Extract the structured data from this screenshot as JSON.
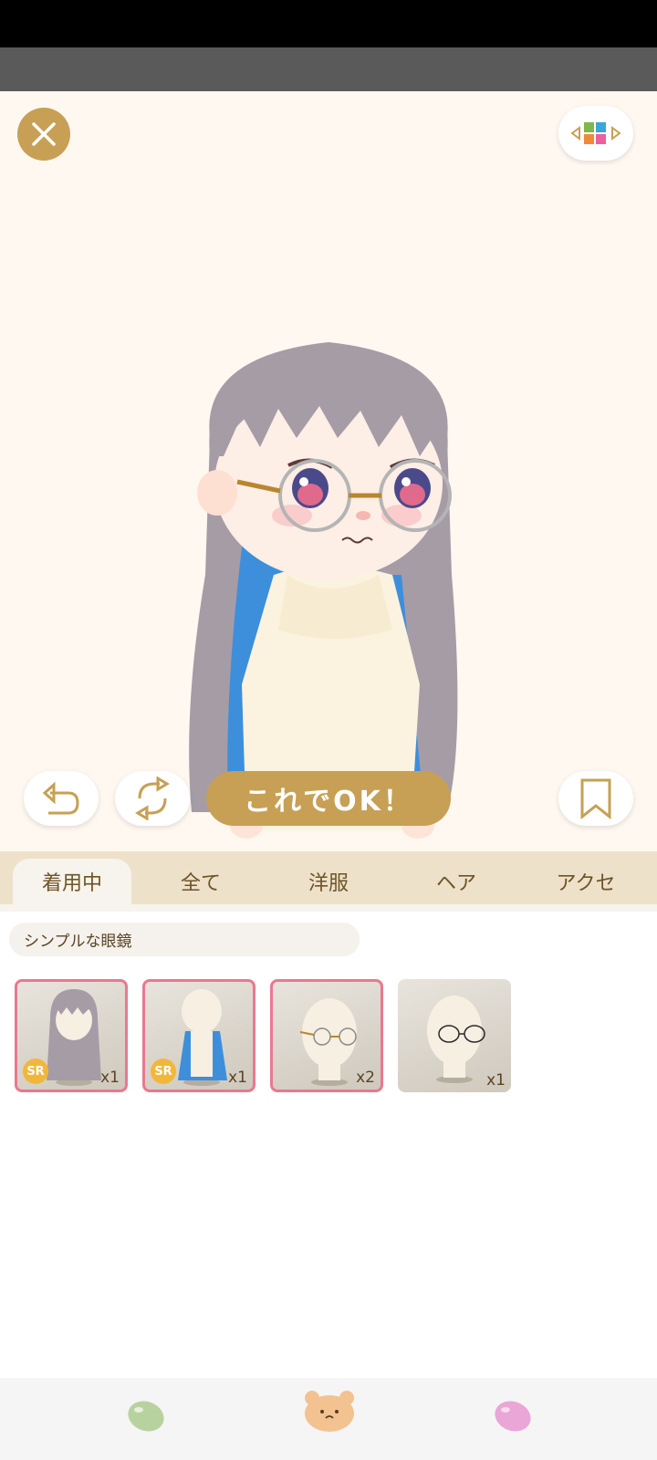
{
  "screen": {
    "close_icon": "close-icon",
    "layout_icon": "four-color-grid-icon"
  },
  "controls": {
    "undo_icon": "undo-arrow-icon",
    "reset_icon": "refresh-cycle-icon",
    "ok_label": "これでOK！",
    "bookmark_icon": "bookmark-icon"
  },
  "tabs": [
    {
      "label": "着用中",
      "active": true
    },
    {
      "label": "全て",
      "active": false
    },
    {
      "label": "洋服",
      "active": false
    },
    {
      "label": "ヘア",
      "active": false
    },
    {
      "label": "アクセ",
      "active": false
    }
  ],
  "selected_item_name": "シンプルな眼鏡",
  "items": [
    {
      "thumb": "long-purple-hair",
      "badge": "SR",
      "count": "x1",
      "selected": true
    },
    {
      "thumb": "blue-inner-hair",
      "badge": "SR",
      "count": "x1",
      "selected": true
    },
    {
      "thumb": "gold-round-glasses",
      "badge": "",
      "count": "x2",
      "selected": true
    },
    {
      "thumb": "black-round-glasses",
      "badge": "",
      "count": "x1",
      "selected": false
    }
  ],
  "bottom_nav": [
    {
      "icon": "green-bean-icon"
    },
    {
      "icon": "bear-face-icon"
    },
    {
      "icon": "pink-bean-icon"
    }
  ],
  "colors": {
    "accent_gold": "#c7a055",
    "stage_bg": "#fff8f1",
    "tab_bg": "#ede1ca",
    "selected_border": "#e8798f",
    "sr_badge": "#f2b73a"
  }
}
